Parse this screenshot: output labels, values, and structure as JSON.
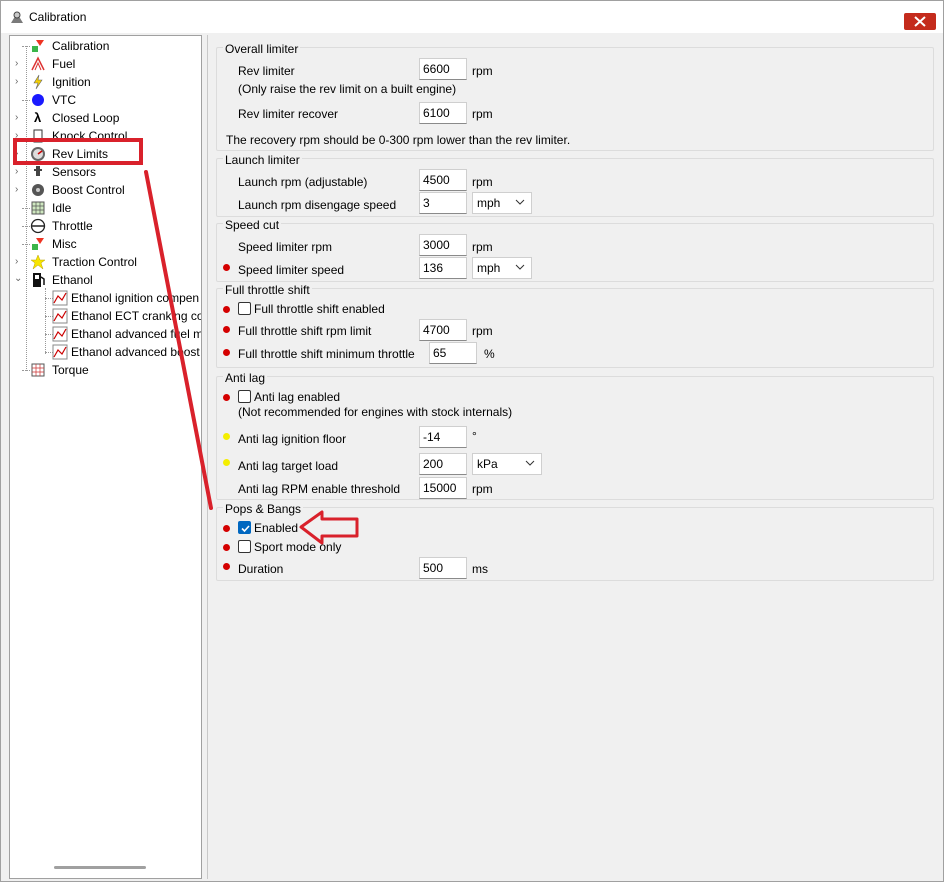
{
  "window": {
    "title": "Calibration"
  },
  "tree": {
    "items": [
      {
        "label": "Calibration",
        "icon": "calibration-icon",
        "expandable": false
      },
      {
        "label": "Fuel",
        "icon": "fuel-icon",
        "expandable": true
      },
      {
        "label": "Ignition",
        "icon": "ignition-icon",
        "expandable": true
      },
      {
        "label": "VTC",
        "icon": "vtc-icon",
        "expandable": false
      },
      {
        "label": "Closed Loop",
        "icon": "lambda-icon",
        "expandable": true
      },
      {
        "label": "Knock Control",
        "icon": "knock-icon",
        "expandable": true
      },
      {
        "label": "Rev Limits",
        "icon": "rev-limits-icon",
        "expandable": true
      },
      {
        "label": "Sensors",
        "icon": "sensors-icon",
        "expandable": true
      },
      {
        "label": "Boost Control",
        "icon": "boost-icon",
        "expandable": true
      },
      {
        "label": "Idle",
        "icon": "idle-icon",
        "expandable": false
      },
      {
        "label": "Throttle",
        "icon": "throttle-icon",
        "expandable": false
      },
      {
        "label": "Misc",
        "icon": "misc-icon",
        "expandable": false
      },
      {
        "label": "Traction Control",
        "icon": "traction-icon",
        "expandable": true
      },
      {
        "label": "Ethanol",
        "icon": "ethanol-icon",
        "expandable": true,
        "expanded": true
      },
      {
        "label": "Ethanol ignition compen",
        "icon": "table-graph-icon",
        "child": true
      },
      {
        "label": "Ethanol ECT cranking co",
        "icon": "table-graph-icon",
        "child": true
      },
      {
        "label": "Ethanol advanced fuel m",
        "icon": "table-graph-icon",
        "child": true
      },
      {
        "label": "Ethanol advanced boost",
        "icon": "table-graph-icon",
        "child": true
      },
      {
        "label": "Torque",
        "icon": "torque-icon",
        "expandable": false
      }
    ]
  },
  "overall_limiter": {
    "title": "Overall limiter",
    "rev_limiter_label": "Rev limiter",
    "rev_limiter_value": "6600",
    "rev_limiter_unit": "rpm",
    "rev_limiter_note": "(Only raise the rev limit on a built engine)",
    "recover_label": "Rev limiter recover",
    "recover_value": "6100",
    "recover_unit": "rpm",
    "hint": "The recovery rpm should be 0-300 rpm lower than the rev limiter."
  },
  "launch_limiter": {
    "title": "Launch limiter",
    "rpm_label": "Launch rpm (adjustable)",
    "rpm_value": "4500",
    "rpm_unit": "rpm",
    "disengage_label": "Launch rpm disengage speed",
    "disengage_value": "3",
    "disengage_unit": "mph"
  },
  "speed_cut": {
    "title": "Speed cut",
    "rpm_label": "Speed limiter rpm",
    "rpm_value": "3000",
    "rpm_unit": "rpm",
    "speed_label": "Speed limiter speed",
    "speed_value": "136",
    "speed_unit": "mph"
  },
  "full_throttle_shift": {
    "title": "Full throttle shift",
    "enabled_label": "Full throttle shift enabled",
    "rpm_limit_label": "Full throttle shift rpm limit",
    "rpm_limit_value": "4700",
    "rpm_limit_unit": "rpm",
    "min_throttle_label": "Full throttle shift minimum throttle",
    "min_throttle_value": "65",
    "min_throttle_unit": "%"
  },
  "anti_lag": {
    "title": "Anti lag",
    "enabled_label": "Anti lag enabled",
    "note": "(Not recommended for engines with stock internals)",
    "ign_floor_label": "Anti lag ignition floor",
    "ign_floor_value": "-14",
    "ign_floor_unit": "°",
    "target_load_label": "Anti lag target load",
    "target_load_value": "200",
    "target_load_unit": "kPa",
    "rpm_threshold_label": "Anti lag RPM enable threshold",
    "rpm_threshold_value": "15000",
    "rpm_threshold_unit": "rpm"
  },
  "pops_bangs": {
    "title": "Pops & Bangs",
    "enabled_label": "Enabled",
    "sport_label": "Sport mode only",
    "duration_label": "Duration",
    "duration_value": "500",
    "duration_unit": "ms"
  },
  "colors": {
    "annotation": "#d9212b",
    "required_dot": "#d40000",
    "warning_dot": "#f4ee00",
    "check_accent": "#0067c0"
  }
}
